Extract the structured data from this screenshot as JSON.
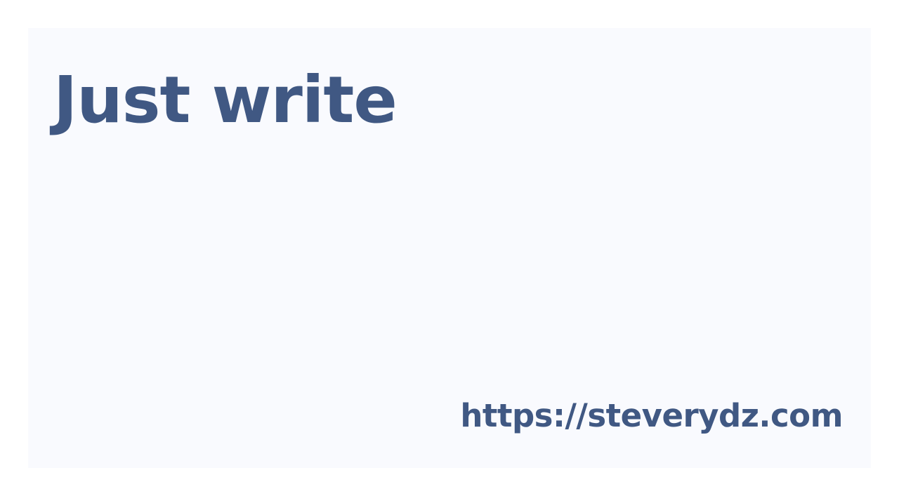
{
  "card": {
    "title": "Just write",
    "url": "https://steverydz.com",
    "colors": {
      "text": "#405883",
      "card_background": "#f9fafe",
      "page_background": "#ffffff"
    }
  }
}
